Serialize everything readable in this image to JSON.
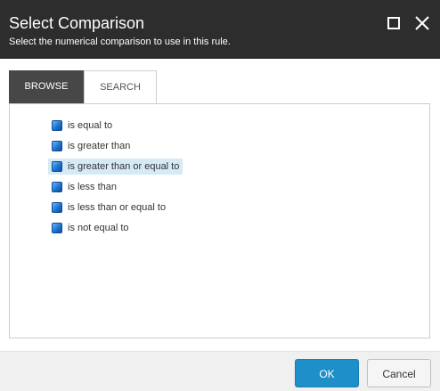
{
  "header": {
    "title": "Select Comparison",
    "subtitle": "Select the numerical comparison to use in this rule."
  },
  "tabs": [
    {
      "label": "BROWSE",
      "active": true
    },
    {
      "label": "SEARCH",
      "active": false
    }
  ],
  "items": [
    {
      "label": "is equal to",
      "selected": false
    },
    {
      "label": "is greater than",
      "selected": false
    },
    {
      "label": "is greater than or equal to",
      "selected": true
    },
    {
      "label": "is less than",
      "selected": false
    },
    {
      "label": "is less than or equal to",
      "selected": false
    },
    {
      "label": "is not equal to",
      "selected": false
    }
  ],
  "footer": {
    "ok_label": "OK",
    "cancel_label": "Cancel"
  },
  "colors": {
    "header_bg": "#2d2d2d",
    "active_tab_bg": "#474747",
    "selected_item_bg": "#d5eaf5",
    "ok_button_bg": "#1f8fc9"
  }
}
